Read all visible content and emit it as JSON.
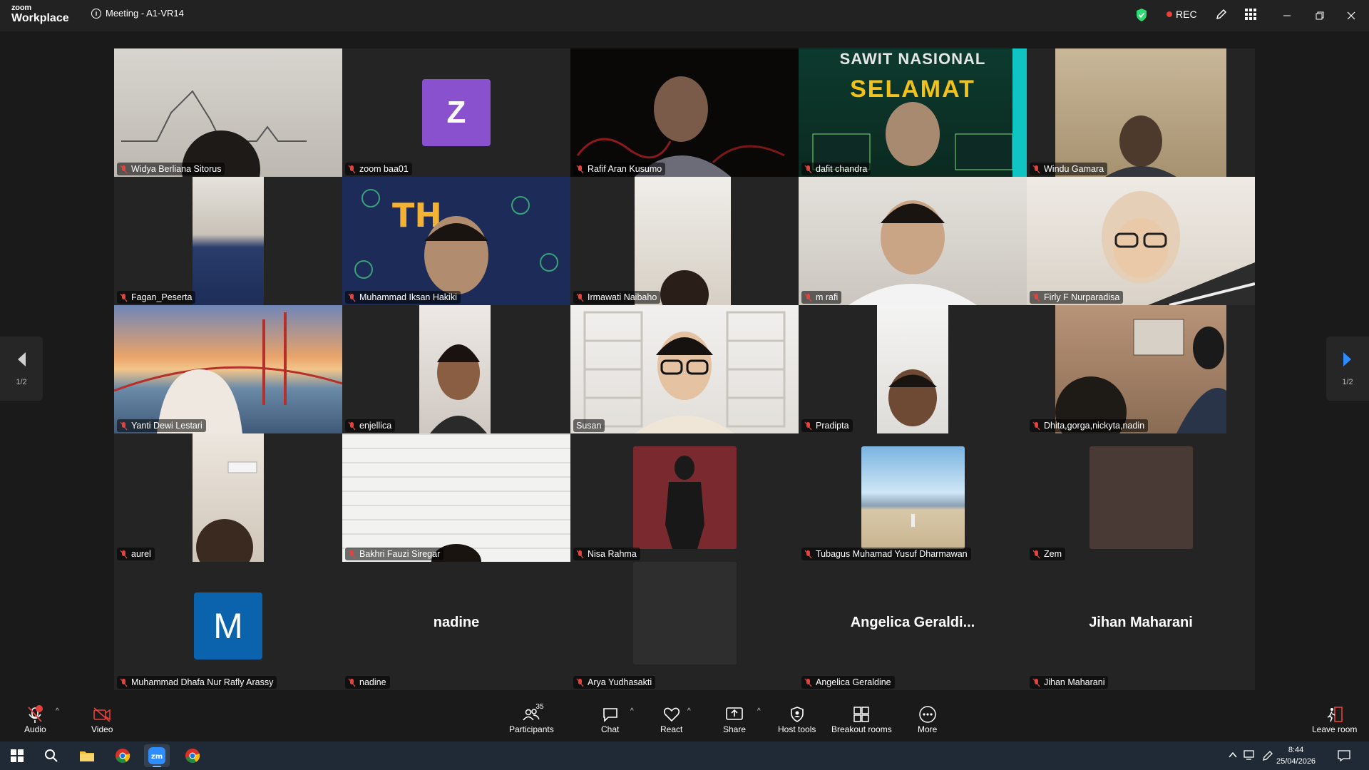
{
  "window": {
    "brand_top": "zoom",
    "brand_bottom": "Workplace",
    "meeting_title": "Meeting - A1-VR14",
    "rec_label": "REC"
  },
  "gallery": {
    "page_indicator_left": "1/2",
    "page_indicator_right": "1/2",
    "tiles": [
      {
        "name": "Widya Berliana Sitorus",
        "muted": true
      },
      {
        "name": "zoom baa01",
        "muted": true,
        "avatar_letter": "Z"
      },
      {
        "name": "Rafif Aran Kusumo",
        "muted": true
      },
      {
        "name": "dafit chandra",
        "muted": true,
        "banner_line1": "SAWIT NASIONAL",
        "banner_line2": "SELAMAT"
      },
      {
        "name": "Windu Gamara",
        "muted": true
      },
      {
        "name": "Fagan_Peserta",
        "muted": true
      },
      {
        "name": "Muhammad Iksan Hakiki",
        "muted": true
      },
      {
        "name": "Irmawati Naibaho",
        "muted": true
      },
      {
        "name": "m rafi",
        "muted": true
      },
      {
        "name": "Firly F Nurparadisa",
        "muted": true
      },
      {
        "name": "Yanti Dewi Lestari",
        "muted": true
      },
      {
        "name": "enjellica",
        "muted": true
      },
      {
        "name": "Susan",
        "muted": false,
        "active_speaker": true
      },
      {
        "name": "Pradipta",
        "muted": true
      },
      {
        "name": "Dhita,gorga,nickyta,nadin",
        "muted": true
      },
      {
        "name": "aurel",
        "muted": true
      },
      {
        "name": "Bakhri Fauzi Siregar",
        "muted": true
      },
      {
        "name": "Nisa Rahma",
        "muted": true
      },
      {
        "name": "Tubagus Muhamad Yusuf Dharmawan",
        "muted": true
      },
      {
        "name": "Zem",
        "muted": true
      },
      {
        "name": "Muhammad Dhafa Nur Rafly Arassy",
        "muted": true,
        "avatar_letter": "M"
      },
      {
        "name": "nadine",
        "muted": true,
        "display_name": "nadine"
      },
      {
        "name": "Arya Yudhasakti",
        "muted": true
      },
      {
        "name": "Angelica Geraldine",
        "muted": true,
        "display_name": "Angelica  Geraldi..."
      },
      {
        "name": "Jihan Maharani",
        "muted": true,
        "display_name": "Jihan Maharani"
      }
    ]
  },
  "toolbar": {
    "audio": "Audio",
    "video": "Video",
    "participants": "Participants",
    "participants_count": "35",
    "chat": "Chat",
    "react": "React",
    "share": "Share",
    "host_tools": "Host tools",
    "breakout_rooms": "Breakout rooms",
    "more": "More",
    "leave_room": "Leave room"
  },
  "taskbar": {
    "time": "8:44",
    "date": "25/04/2026"
  },
  "colors": {
    "active_speaker": "#2ddc70",
    "rec": "#e8403c",
    "muted_icon": "#e8403c",
    "avatar_z": "#8a51cf",
    "avatar_m": "#0b63ae"
  }
}
